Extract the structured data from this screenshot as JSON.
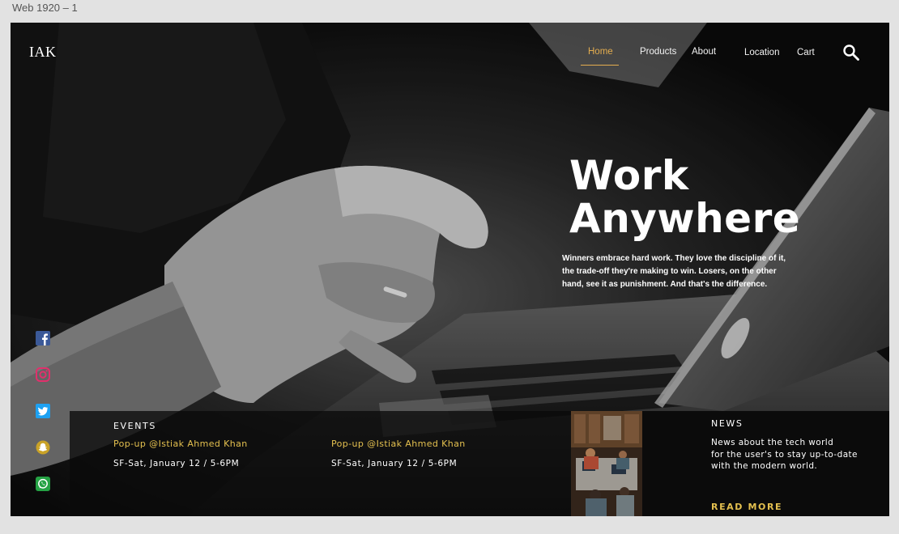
{
  "artboard_label": "Web 1920 – 1",
  "header": {
    "logo": "IAK",
    "nav": [
      {
        "label": "Home",
        "active": true
      },
      {
        "label": "Products",
        "active": false
      },
      {
        "label": "About",
        "active": false
      },
      {
        "label": "Location",
        "active": false
      },
      {
        "label": "Cart",
        "active": false
      }
    ],
    "search_icon": "search-icon"
  },
  "hero": {
    "headline_line1": "Work",
    "headline_line2": "Anywhere",
    "tagline_line1": "Winners embrace hard work. They love the discipline of it,",
    "tagline_line2": "the trade-off they're making to win. Losers, on the other",
    "tagline_line3": "hand, see it as punishment. And that's the difference."
  },
  "social": [
    {
      "icon": "facebook-icon",
      "color": "#3b5998"
    },
    {
      "icon": "instagram-icon",
      "color": "#e1306c"
    },
    {
      "icon": "twitter-icon",
      "color": "#1da1f2"
    },
    {
      "icon": "snapchat-icon",
      "color": "#c9a227"
    },
    {
      "icon": "whatsapp-icon",
      "color": "#25a244"
    }
  ],
  "events": {
    "title": "EVENTS",
    "items": [
      {
        "name": "Pop-up @Istiak Ahmed Khan",
        "date": "SF-Sat, January 12 / 5-6PM"
      },
      {
        "name": "Pop-up @Istiak Ahmed Khan",
        "date": "SF-Sat, January 12 / 5-6PM"
      }
    ]
  },
  "news": {
    "title": "NEWS",
    "body_line1": "News about the tech world",
    "body_line2": "for the user's to stay up-to-date",
    "body_line3": "with the modern world.",
    "cta": "READ MORE"
  },
  "colors": {
    "accent": "#e4ad4f",
    "gold": "#e4c04f",
    "panel": "#0b0b0b"
  }
}
